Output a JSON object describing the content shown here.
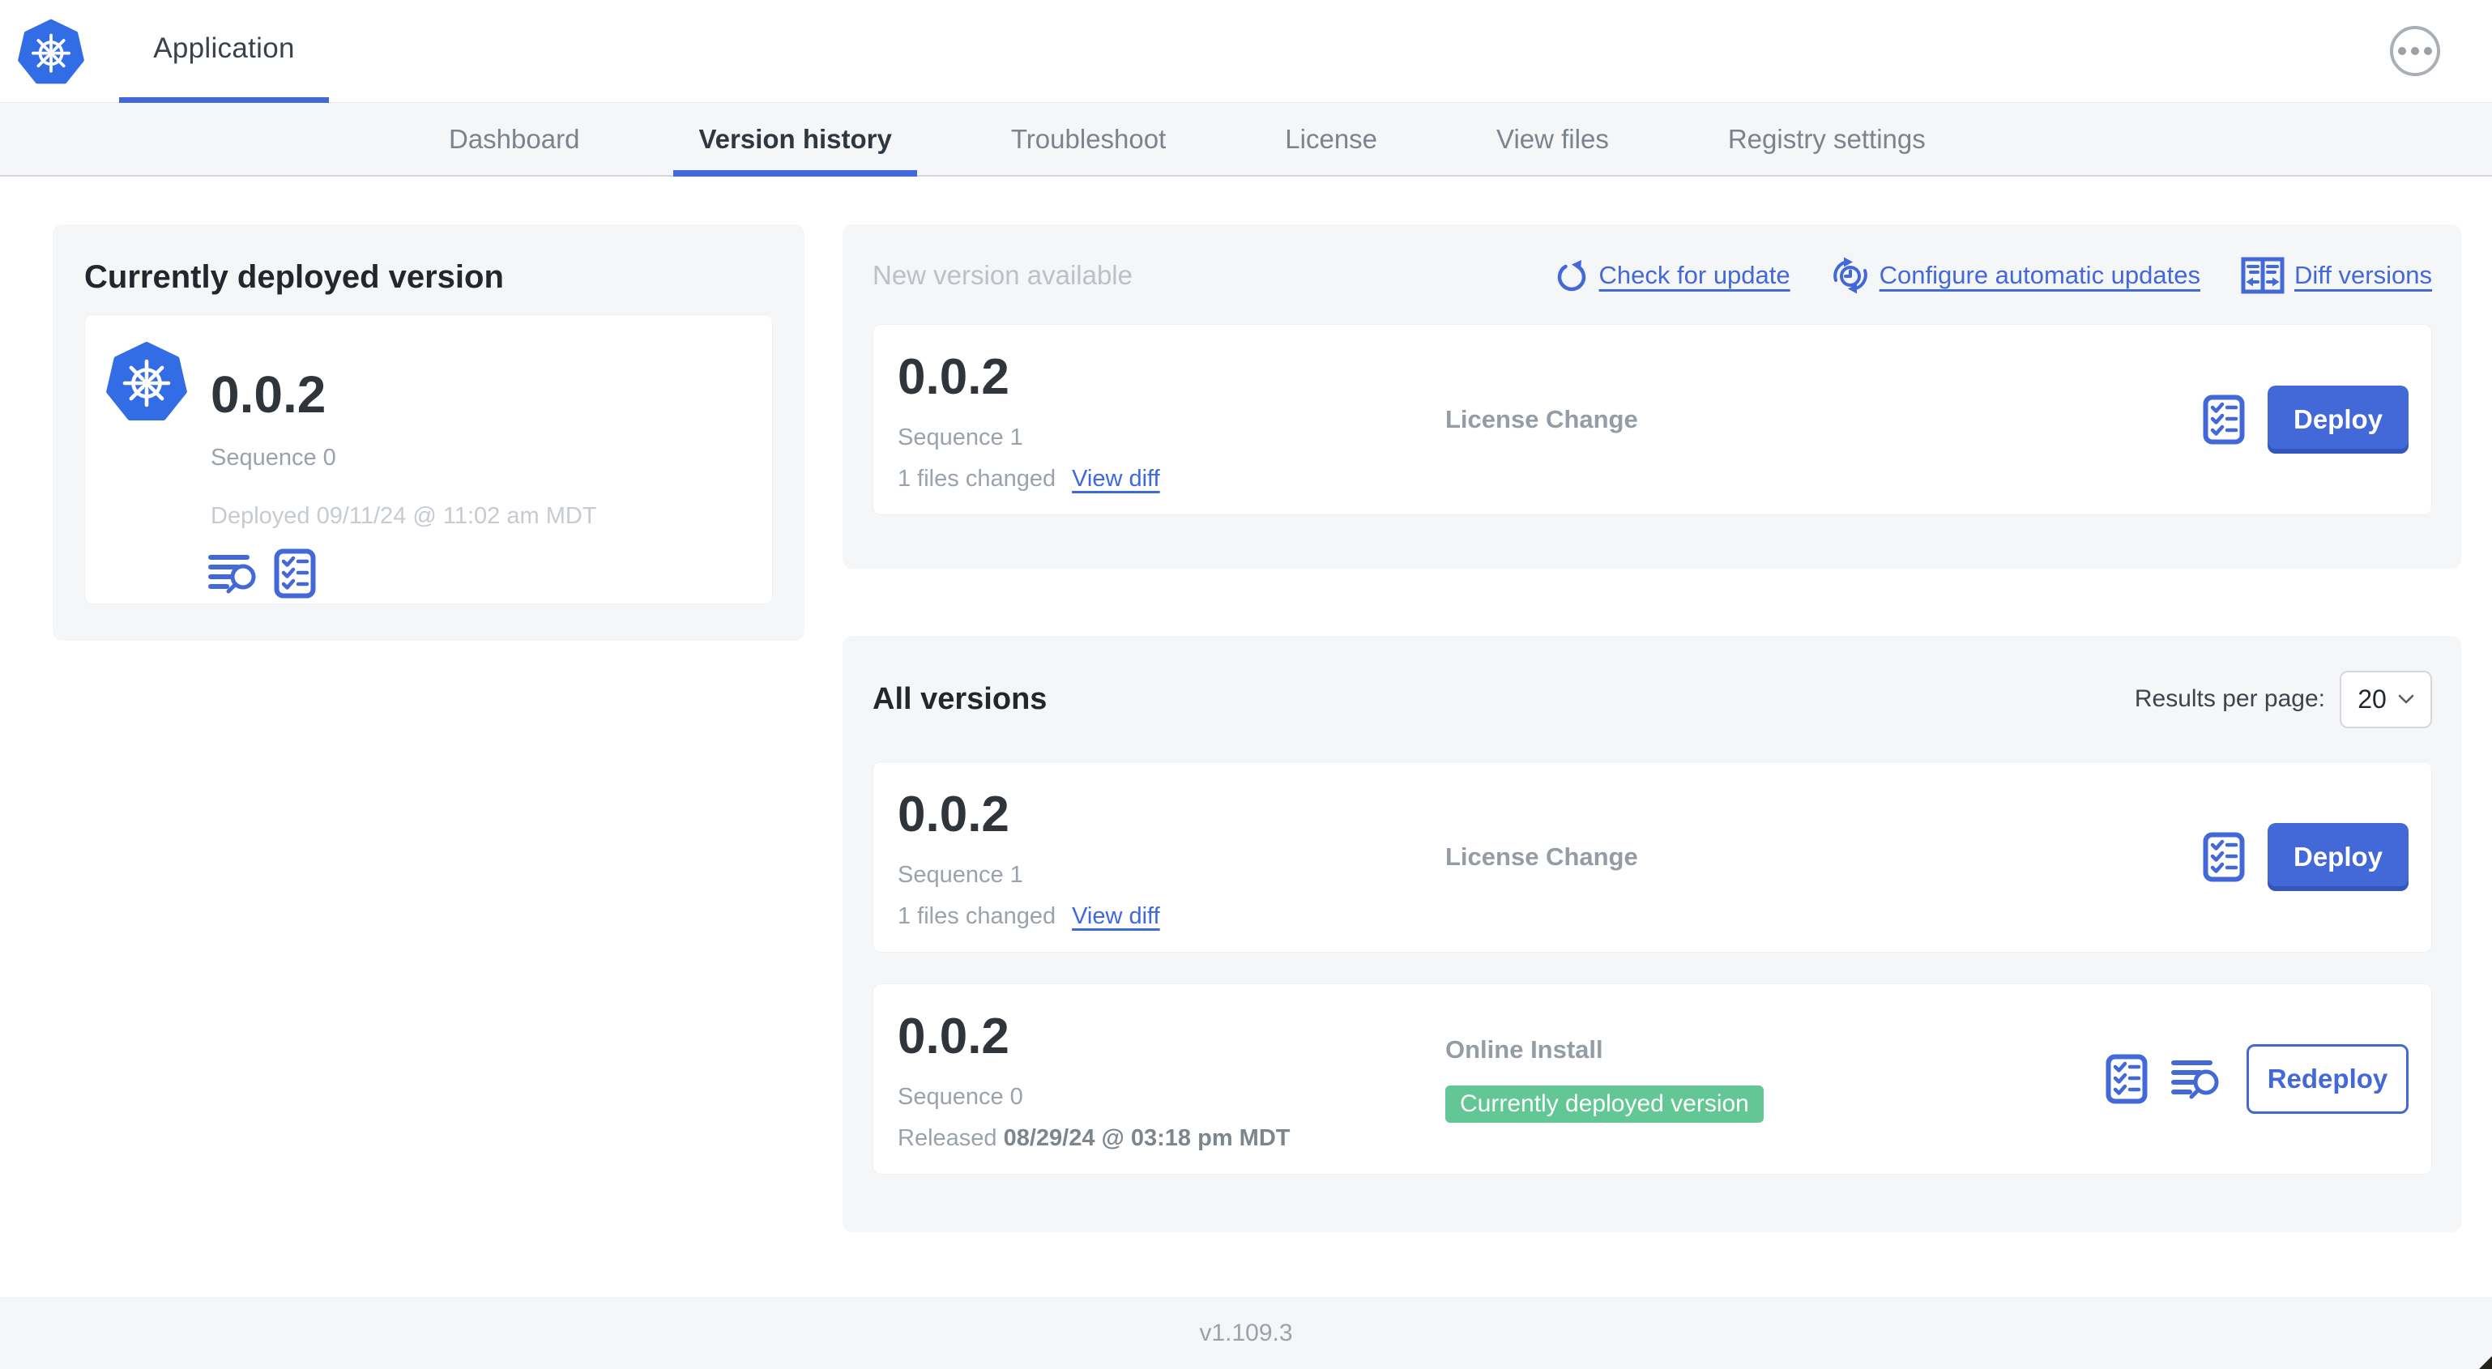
{
  "colors": {
    "accent_blue": "#4368d8",
    "kubernetes_blue": "#326de6",
    "badge_green": "#63c795",
    "card_bg": "#f4f6f8"
  },
  "header": {
    "app_label": "Application"
  },
  "nav": {
    "tabs": [
      {
        "label": "Dashboard"
      },
      {
        "label": "Version history"
      },
      {
        "label": "Troubleshoot"
      },
      {
        "label": "License"
      },
      {
        "label": "View files"
      },
      {
        "label": "Registry settings"
      }
    ]
  },
  "current_version": {
    "title": "Currently deployed version",
    "version": "0.0.2",
    "sequence": "Sequence 0",
    "deployed": "Deployed 09/11/24 @ 11:02 am MDT"
  },
  "new_version": {
    "title": "New version available",
    "actions": [
      {
        "label": "Check for update",
        "icon": "refresh-icon"
      },
      {
        "label": "Configure automatic updates",
        "icon": "auto-update-icon"
      },
      {
        "label": "Diff versions",
        "icon": "diff-icon"
      }
    ],
    "row": {
      "version": "0.0.2",
      "sequence": "Sequence 1",
      "files_changed": "1 files changed",
      "view_diff": "View diff",
      "source": "License Change",
      "action": "Deploy"
    }
  },
  "all_versions": {
    "title": "All versions",
    "results_per_page_label": "Results per page:",
    "results_per_page_value": "20",
    "rows": [
      {
        "version": "0.0.2",
        "sequence": "Sequence 1",
        "files_changed": "1 files changed",
        "view_diff": "View diff",
        "source": "License Change",
        "action": "Deploy"
      },
      {
        "version": "0.0.2",
        "sequence": "Sequence 0",
        "released_prefix": "Released",
        "released_date": "08/29/24 @ 03:18 pm MDT",
        "source": "Online Install",
        "badge": "Currently deployed version",
        "action": "Redeploy"
      }
    ]
  },
  "footer": {
    "app_version": "v1.109.3"
  }
}
